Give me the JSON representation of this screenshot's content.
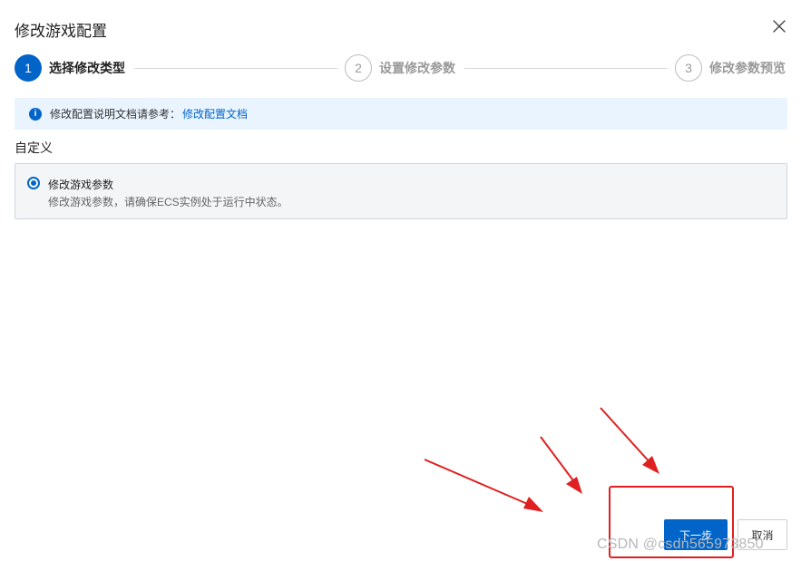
{
  "dialog": {
    "title": "修改游戏配置"
  },
  "steps": [
    {
      "number": "1",
      "label": "选择修改类型",
      "state": "active"
    },
    {
      "number": "2",
      "label": "设置修改参数",
      "state": "inactive"
    },
    {
      "number": "3",
      "label": "修改参数预览",
      "state": "inactive"
    }
  ],
  "info": {
    "text": "修改配置说明文档请参考：",
    "link": "修改配置文档",
    "icon": "info-icon"
  },
  "section": {
    "title": "自定义"
  },
  "option": {
    "title": "修改游戏参数",
    "description": "修改游戏参数，请确保ECS实例处于运行中状态。",
    "selected": true
  },
  "buttons": {
    "next": "下一步",
    "cancel": "取消"
  },
  "watermark": "CSDN @csdn565973850",
  "colors": {
    "brand": "#0064c8",
    "annotation": "#e02020",
    "info_background": "#eaf4ff"
  }
}
